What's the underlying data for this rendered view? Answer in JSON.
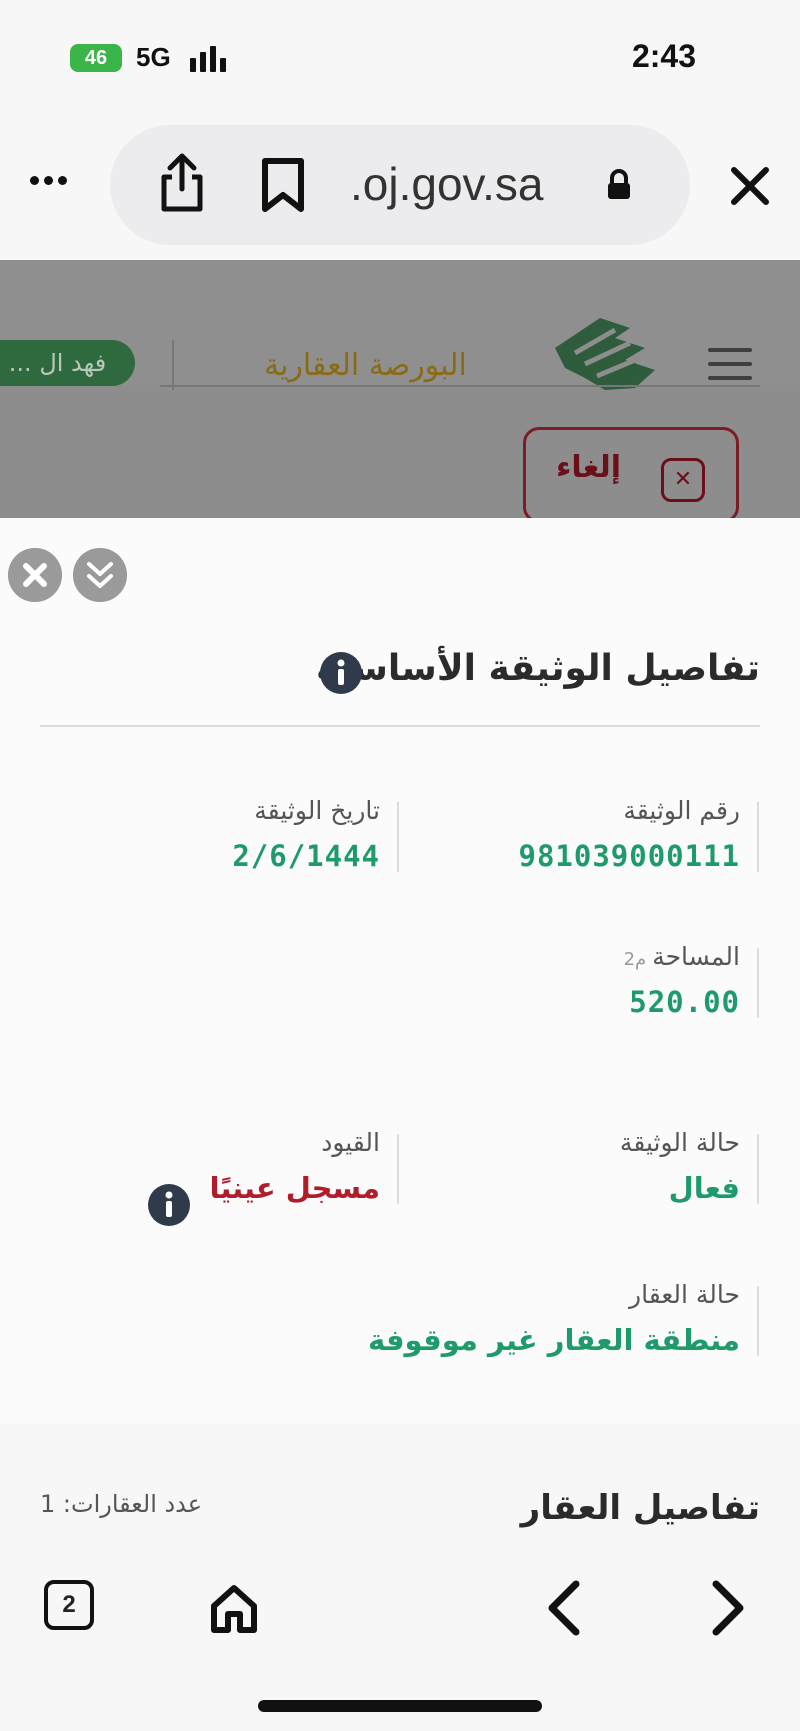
{
  "status_bar": {
    "battery": "46",
    "network": "5G",
    "time": "2:43"
  },
  "browser": {
    "url": ".oj.gov.sa"
  },
  "site": {
    "logo_text": "البورصة العقارية",
    "user_label": "فهد ال ...",
    "cancel_label": "إلغاء"
  },
  "doc": {
    "title": "تفاصيل الوثيقة الأساسية",
    "fields": {
      "doc_number": {
        "label": "رقم الوثيقة",
        "value": "981039000111"
      },
      "doc_date": {
        "label": "تاريخ الوثيقة",
        "value": "2/6/1444"
      },
      "area": {
        "label": "المساحة",
        "unit": "م2",
        "value": "520.00"
      },
      "doc_status": {
        "label": "حالة الوثيقة",
        "value": "فعال"
      },
      "restrictions": {
        "label": "القيود",
        "value": "مسجل عينيًا"
      },
      "property_status": {
        "label": "حالة العقار",
        "value": "منطقة العقار غير موقوفة"
      }
    }
  },
  "property": {
    "title": "تفاصيل العقار",
    "count_label": "عدد العقارات: 1"
  },
  "toolbar": {
    "tabs_count": "2"
  },
  "colors": {
    "value_green": "#1f9a6a",
    "restriction_red": "#b01c2a",
    "header_gold": "#8a6a14"
  }
}
